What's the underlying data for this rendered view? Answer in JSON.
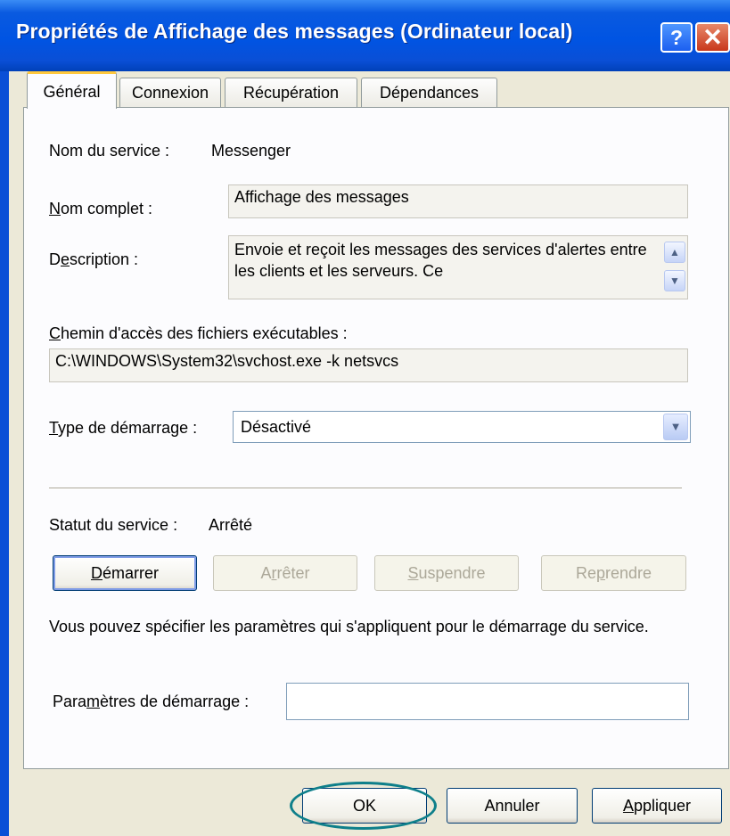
{
  "window": {
    "title": "Propriétés de Affichage des messages (Ordinateur local)",
    "help_glyph": "?",
    "close_glyph": "✕"
  },
  "tabs": [
    {
      "label": "Général"
    },
    {
      "label": "Connexion"
    },
    {
      "label": "Récupération"
    },
    {
      "label": "Dépendances"
    }
  ],
  "general": {
    "service_name_label": "Nom du service :",
    "service_name_value": "Messenger",
    "display_name_label": "Nom complet :",
    "display_name_value": "Affichage des messages",
    "description_label": "Description :",
    "description_value": "Envoie et reçoit les messages des services d'alertes entre les clients et les serveurs. Ce",
    "path_label": "Chemin d'accès des fichiers exécutables :",
    "path_value": "C:\\WINDOWS\\System32\\svchost.exe -k netsvcs",
    "startup_type_label": "Type de démarrage :",
    "startup_type_value": "Désactivé",
    "status_label": "Statut du service :",
    "status_value": "Arrêté",
    "buttons": {
      "start": "Démarrer",
      "stop": "Arrêter",
      "pause": "Suspendre",
      "resume": "Reprendre"
    },
    "help_text": "Vous pouvez spécifier les paramètres qui s'appliquent pour le démarrage du service.",
    "start_params_label": "Paramètres de démarrage :",
    "start_params_value": ""
  },
  "footer": {
    "ok": "OK",
    "cancel": "Annuler",
    "apply": "Appliquer"
  },
  "icons": {
    "help": "help-icon",
    "close": "close-icon",
    "scroll_up": "chevron-up-icon",
    "scroll_down": "chevron-down-icon",
    "dropdown": "chevron-down-icon"
  }
}
